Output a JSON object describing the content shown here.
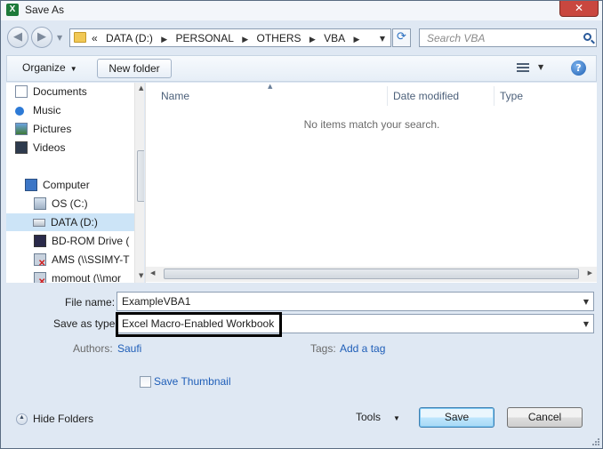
{
  "window": {
    "title": "Save As",
    "app_icon_letter": "X",
    "close_glyph": "✕"
  },
  "address_bar": {
    "overflow": "«",
    "crumbs": [
      "DATA (D:)",
      "PERSONAL",
      "OTHERS",
      "VBA"
    ],
    "separator": "▶"
  },
  "search": {
    "placeholder": "Search VBA"
  },
  "toolbar": {
    "organize_label": "Organize",
    "new_folder_label": "New folder",
    "help_glyph": "?"
  },
  "nav_pane": {
    "items": [
      {
        "label": "Documents",
        "icon": "documents-icon"
      },
      {
        "label": "Music",
        "icon": "music-icon"
      },
      {
        "label": "Pictures",
        "icon": "pictures-icon"
      },
      {
        "label": "Videos",
        "icon": "videos-icon"
      },
      {
        "label": "Computer",
        "icon": "computer-icon"
      },
      {
        "label": "OS (C:)",
        "icon": "os-drive-icon"
      },
      {
        "label": "DATA (D:)",
        "icon": "data-drive-icon",
        "selected": true
      },
      {
        "label": "BD-ROM Drive (",
        "icon": "bd-rom-icon"
      },
      {
        "label": "AMS (\\\\SSIMY-T",
        "icon": "network-drive-disconnected-icon"
      },
      {
        "label": "momout (\\\\mor",
        "icon": "network-drive-disconnected-icon"
      }
    ]
  },
  "file_list": {
    "columns": [
      "Name",
      "Date modified",
      "Type"
    ],
    "empty_message": "No items match your search."
  },
  "form": {
    "file_name_label": "File name:",
    "file_name_value": "ExampleVBA1",
    "save_as_type_label": "Save as type:",
    "save_as_type_value": "Excel Macro-Enabled Workbook",
    "authors_label": "Authors:",
    "authors_value": "Saufi",
    "tags_label": "Tags:",
    "tags_value": "Add a tag",
    "save_thumbnail_label": "Save Thumbnail",
    "save_thumbnail_checked": false
  },
  "footer": {
    "hide_folders_label": "Hide Folders",
    "tools_label": "Tools",
    "save_label": "Save",
    "cancel_label": "Cancel"
  },
  "colors": {
    "window_bg": "#dfe8f3",
    "close_red": "#c9473f",
    "link_blue": "#1f5eb8",
    "selected_bg": "#cce4f7",
    "highlight_border": "#000000"
  }
}
